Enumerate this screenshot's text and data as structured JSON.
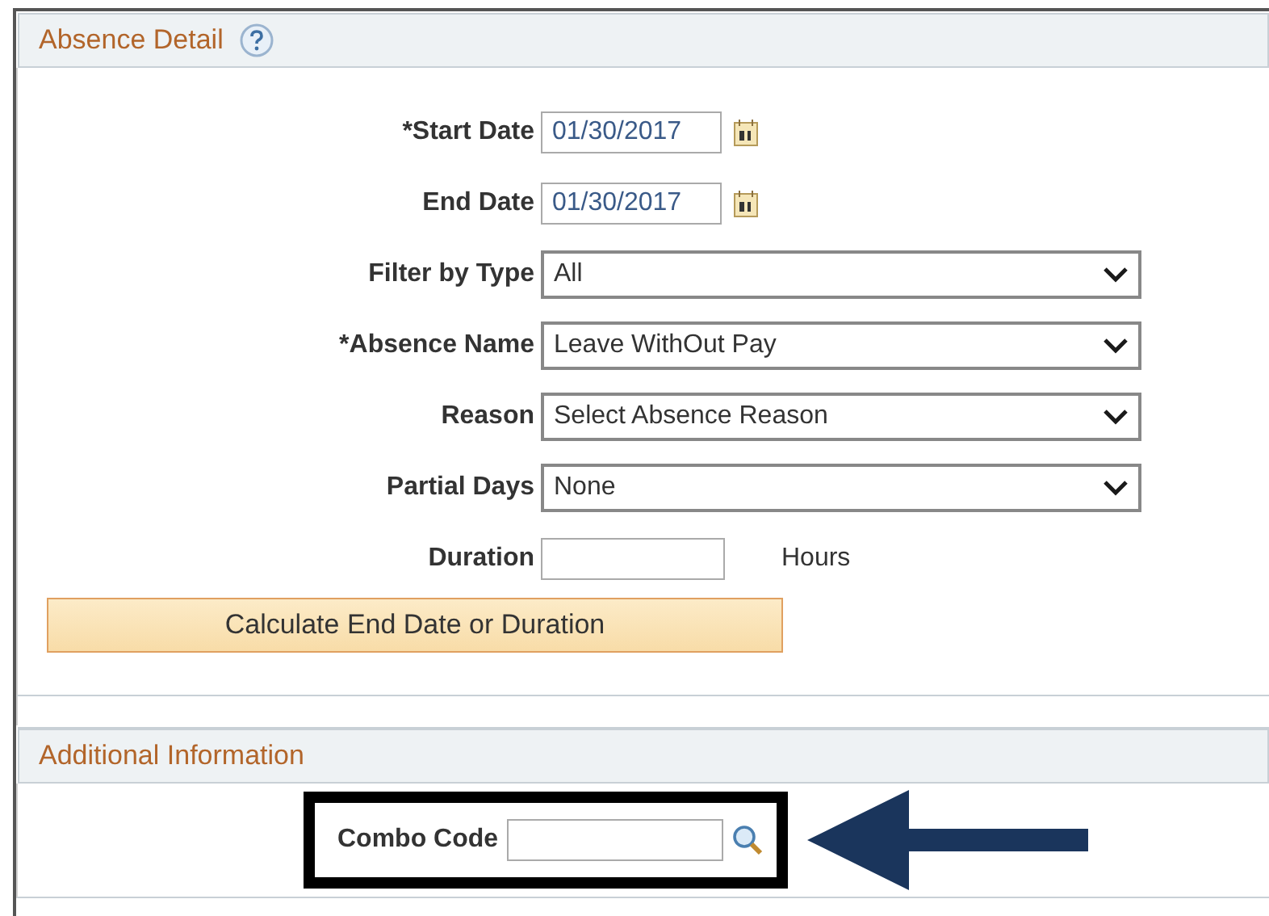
{
  "absence_detail": {
    "title": "Absence Detail",
    "fields": [
      {
        "kind": "date",
        "label": "*Start Date",
        "value": "01/30/2017"
      },
      {
        "kind": "date",
        "label": "End Date",
        "value": "01/30/2017"
      },
      {
        "kind": "select",
        "label": "Filter by Type",
        "value": "All"
      },
      {
        "kind": "select",
        "label": "*Absence Name",
        "value": "Leave WithOut Pay"
      },
      {
        "kind": "select",
        "label": "Reason",
        "value": "Select Absence Reason"
      },
      {
        "kind": "select",
        "label": "Partial Days",
        "value": "None"
      },
      {
        "kind": "number",
        "label": "Duration",
        "unit": "Hours"
      }
    ],
    "button": "Calculate End Date or Duration"
  },
  "additional_information": {
    "title": "Additional Information",
    "field": {
      "label": "Combo Code"
    }
  }
}
